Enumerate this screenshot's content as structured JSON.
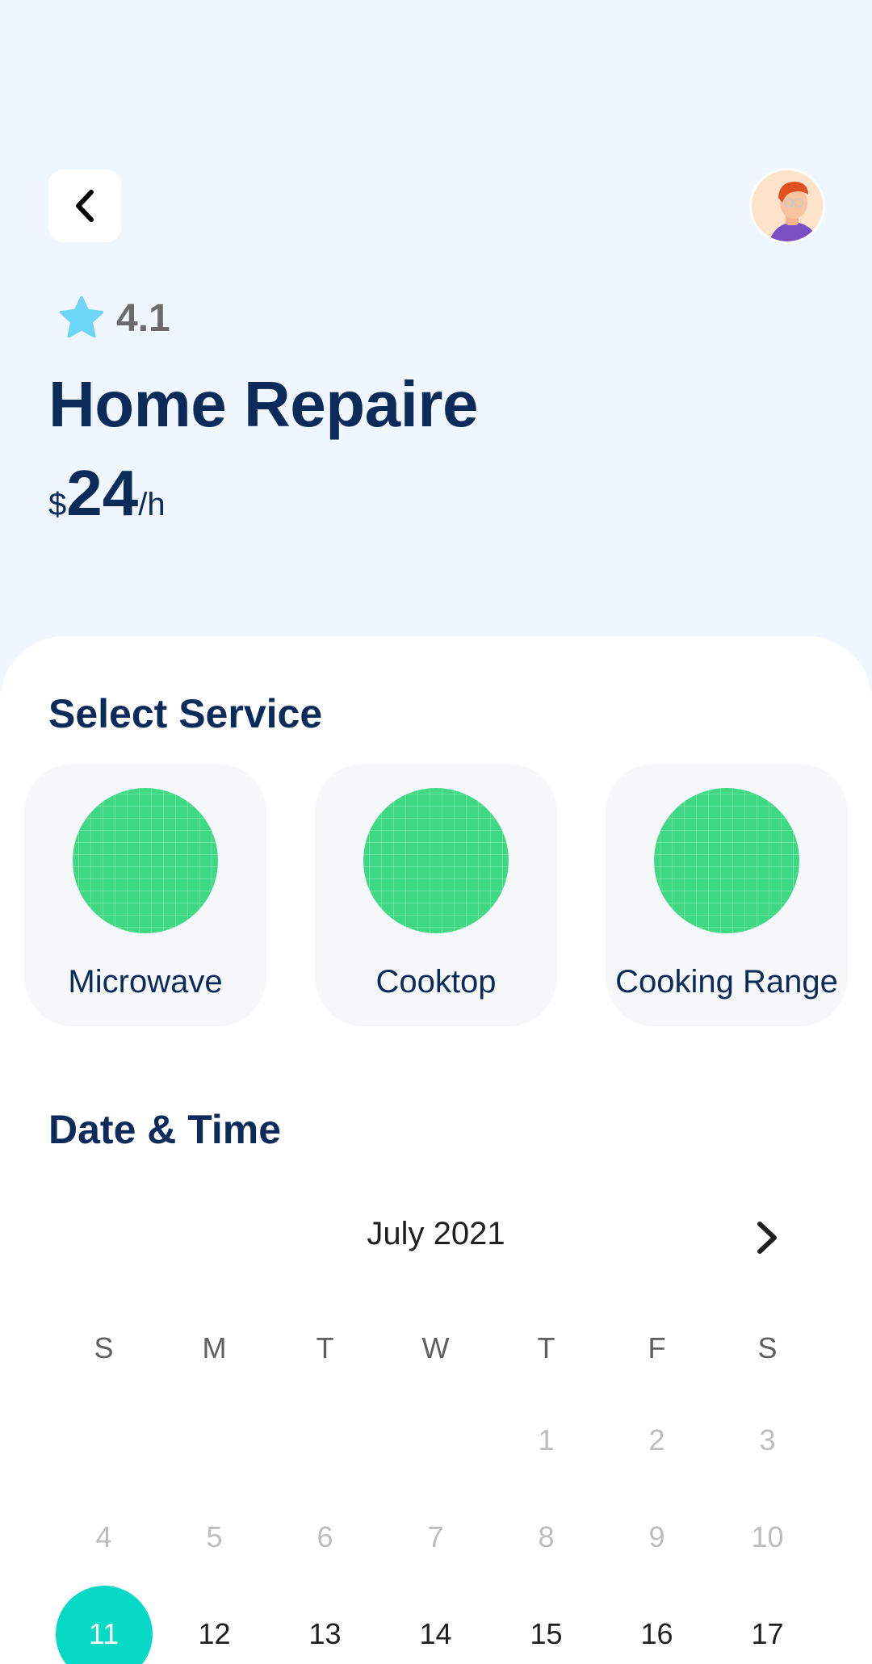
{
  "header": {
    "rating": "4.1",
    "title": "Home Repaire",
    "price_currency": "$",
    "price_amount": "24",
    "price_unit": "/h"
  },
  "service_section": {
    "title": "Select Service",
    "items": [
      {
        "label": "Microwave"
      },
      {
        "label": "Cooktop"
      },
      {
        "label": "Cooking Range"
      }
    ]
  },
  "datetime_section": {
    "title": "Date & Time",
    "month": "July 2021",
    "weekdays": [
      "S",
      "M",
      "T",
      "W",
      "T",
      "F",
      "S"
    ],
    "weeks": [
      [
        "",
        "",
        "",
        "",
        "1",
        "2",
        "3"
      ],
      [
        "4",
        "5",
        "6",
        "7",
        "8",
        "9",
        "10"
      ],
      [
        "11",
        "12",
        "13",
        "14",
        "15",
        "16",
        "17"
      ]
    ],
    "selected_day": "11"
  },
  "colors": {
    "title": "#0c2b5b",
    "accent": "#06d9c5",
    "service_circle": "#3fd985",
    "star": "#6dd5f7",
    "background": "#eff6fe"
  },
  "icons": {
    "back": "chevron-left-icon",
    "next": "chevron-right-icon",
    "rating": "star-icon"
  }
}
